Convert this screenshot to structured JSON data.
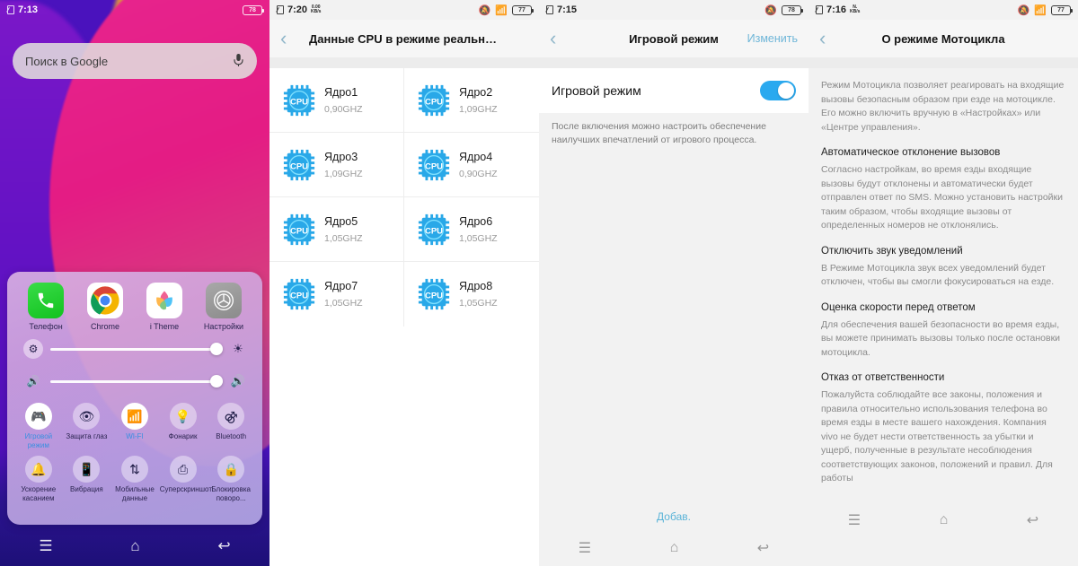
{
  "panels": {
    "home": {
      "status": {
        "time": "7:13",
        "battery": "78",
        "sim_icon": "sim-card-icon"
      },
      "search": {
        "placeholder": "Поиск в Google",
        "mic_icon": "microphone-icon",
        "search_icon": "search-icon"
      },
      "apps": [
        {
          "label": "Телефон",
          "icon": "phone-icon"
        },
        {
          "label": "Chrome",
          "icon": "chrome-icon"
        },
        {
          "label": "i Theme",
          "icon": "itheme-icon"
        },
        {
          "label": "Настройки",
          "icon": "settings-gear-icon"
        }
      ],
      "sliders": [
        {
          "name": "brightness",
          "start_icon": "gear-icon",
          "end_icon": "brightness-icon",
          "value": "100"
        },
        {
          "name": "volume",
          "start_icon": "volume-low-icon",
          "end_icon": "volume-high-icon",
          "value": "100"
        }
      ],
      "toggles": [
        {
          "label": "Игровой режим",
          "icon": "game-controller-icon",
          "on": true
        },
        {
          "label": "Защита глаз",
          "icon": "eye-protection-icon",
          "on": false
        },
        {
          "label": "WI-FI",
          "icon": "wifi-icon",
          "on": true
        },
        {
          "label": "Фонарик",
          "icon": "flashlight-icon",
          "on": false
        },
        {
          "label": "Bluetooth",
          "icon": "bluetooth-icon",
          "on": false
        },
        {
          "label": "Ускорение касанием",
          "icon": "touch-boost-icon",
          "on": false
        },
        {
          "label": "Вибрация",
          "icon": "vibration-icon",
          "on": false
        },
        {
          "label": "Мобильные данные",
          "icon": "mobile-data-icon",
          "on": false
        },
        {
          "label": "Суперскриншот",
          "icon": "super-screenshot-icon",
          "on": false
        },
        {
          "label": "Блокировка поворо...",
          "icon": "rotation-lock-icon",
          "on": false
        }
      ],
      "navbar": [
        {
          "name": "recents-button",
          "icon": "menu-icon",
          "glyph": "☰"
        },
        {
          "name": "home-button",
          "icon": "home-icon",
          "glyph": "⌂"
        },
        {
          "name": "back-button",
          "icon": "back-icon",
          "glyph": "↩"
        }
      ]
    },
    "cpu": {
      "status": {
        "time": "7:20",
        "netspeed_value": "0.00",
        "netspeed_unit": "KB/s",
        "battery": "77"
      },
      "appbar": {
        "title": "Данные CPU в режиме реального...",
        "back_icon": "back-chevron-icon"
      },
      "cores": [
        {
          "name": "Ядро1",
          "freq": "0,90GHZ"
        },
        {
          "name": "Ядро2",
          "freq": "1,09GHZ"
        },
        {
          "name": "Ядро3",
          "freq": "1,09GHZ"
        },
        {
          "name": "Ядро4",
          "freq": "0,90GHZ"
        },
        {
          "name": "Ядро5",
          "freq": "1,05GHZ"
        },
        {
          "name": "Ядро6",
          "freq": "1,05GHZ"
        },
        {
          "name": "Ядро7",
          "freq": "1,05GHZ"
        },
        {
          "name": "Ядро8",
          "freq": "1,05GHZ"
        }
      ],
      "cpu_icon_text": "CPU",
      "navbar": [
        {
          "name": "recents-button",
          "glyph": "☰"
        },
        {
          "name": "home-button",
          "glyph": "⌂"
        },
        {
          "name": "back-button",
          "glyph": "↩"
        }
      ]
    },
    "game": {
      "status": {
        "time": "7:15",
        "battery": "78"
      },
      "appbar": {
        "title": "Игровой режим",
        "action": "Изменить",
        "back_icon": "back-chevron-icon"
      },
      "row": {
        "label": "Игровой режим",
        "switch_on": true
      },
      "hint": "После включения можно настроить обеспечение наилучших впечатлений от игрового процесса.",
      "add_button": "Добав.",
      "navbar": [
        {
          "name": "recents-button",
          "glyph": "☰"
        },
        {
          "name": "home-button",
          "glyph": "⌂"
        },
        {
          "name": "back-button",
          "glyph": "↩"
        }
      ]
    },
    "moto": {
      "status": {
        "time": "7:16",
        "netspeed_value": "N.",
        "netspeed_unit": "KB/s",
        "battery": "77"
      },
      "appbar": {
        "title": "О режиме Мотоцикла",
        "back_icon": "back-chevron-icon"
      },
      "intro": "Режим Мотоцикла позволяет реагировать на входящие вызовы безопасным образом при езде на мотоцикле. Его можно включить вручную в «Настройках» или «Центре управления».",
      "sections": [
        {
          "heading": "Автоматическое отклонение вызовов",
          "body": "Согласно настройкам, во время езды входящие вызовы будут отклонены и автоматически будет отправлен ответ по SMS. Можно установить настройки таким образом, чтобы входящие вызовы от определенных номеров не отклонялись."
        },
        {
          "heading": "Отключить звук уведомлений",
          "body": "В Режиме Мотоцикла звук всех уведомлений будет отключен, чтобы вы смогли фокусироваться на езде."
        },
        {
          "heading": "Оценка скорости перед ответом",
          "body": "Для обеспечения вашей безопасности во время езды, вы можете принимать вызовы только после остановки мотоцикла."
        },
        {
          "heading": "Отказ от ответственности",
          "body": "Пожалуйста соблюдайте все законы, положения и правила относительно использования телефона во время езды в месте вашего нахождения. Компания vivo не будет нести ответственность за убытки и ущерб, полученные в результате несоблюдения соответствующих законов, положений и правил. Для работы"
        }
      ],
      "navbar": [
        {
          "name": "recents-button",
          "glyph": "☰"
        },
        {
          "name": "home-button",
          "glyph": "⌂"
        },
        {
          "name": "back-button",
          "glyph": "↩"
        }
      ]
    }
  },
  "colors": {
    "accent_blue": "#2aa9ef",
    "link_blue": "#6fb6d8",
    "cpu_blue": "#29a8e8",
    "panel_bg": "#f2f2f2"
  }
}
